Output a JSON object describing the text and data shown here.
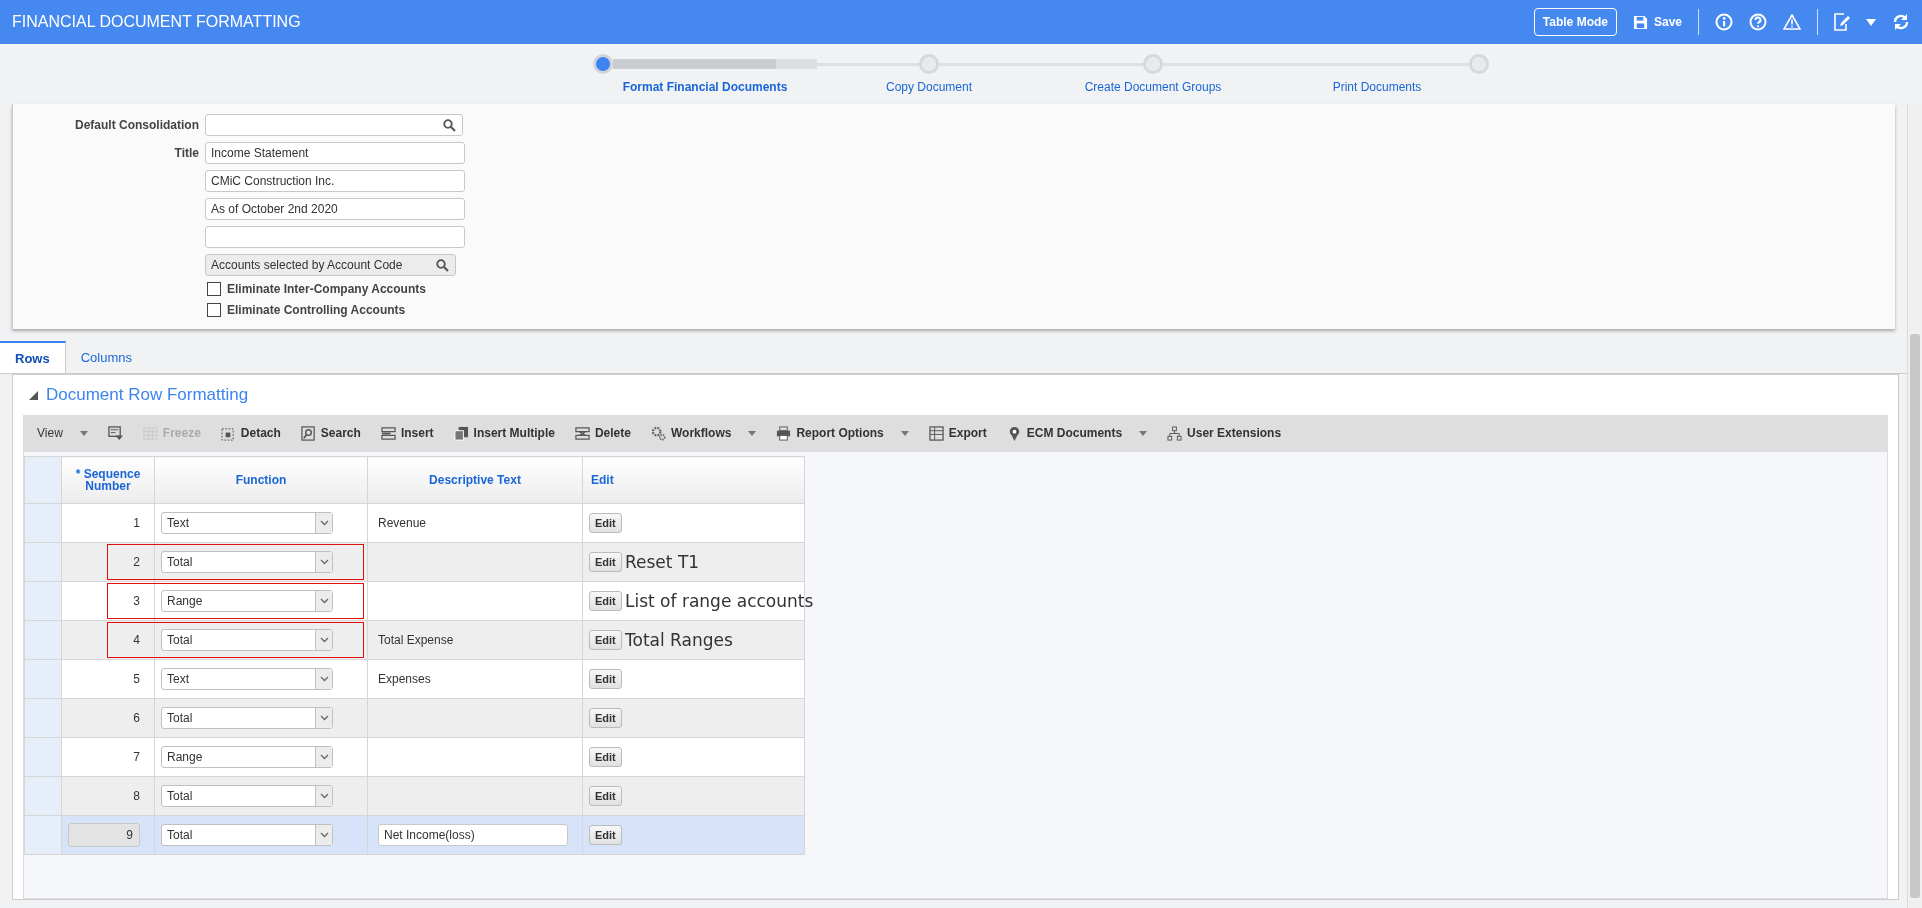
{
  "header": {
    "title": "FINANCIAL DOCUMENT FORMATTING",
    "table_mode": "Table Mode",
    "save": "Save"
  },
  "steps": [
    {
      "label": "Format Financial Documents",
      "selected": true
    },
    {
      "label": "Copy Document",
      "selected": false
    },
    {
      "label": "Create Document Groups",
      "selected": false
    },
    {
      "label": "Print Documents",
      "selected": false
    }
  ],
  "form": {
    "consolidation_label": "Default Consolidation",
    "title_label": "Title",
    "title_lines": [
      "Income Statement",
      "CMiC Construction Inc.",
      "As of October 2nd 2020"
    ],
    "blank_title_line": true,
    "account_selection": "Accounts selected by Account Code",
    "checkboxes": [
      {
        "label": "Eliminate Inter-Company Accounts",
        "checked": false
      },
      {
        "label": "Eliminate Controlling Accounts",
        "checked": false
      }
    ]
  },
  "tabs": [
    {
      "label": "Rows",
      "selected": true
    },
    {
      "label": "Columns",
      "selected": false
    }
  ],
  "section_title": "Document Row Formatting",
  "toolbar": [
    {
      "label": "View",
      "disabled": false,
      "dropdown": true
    },
    {
      "disabled": false,
      "dropdown": false
    },
    {
      "label": "Freeze",
      "disabled": true,
      "dropdown": false
    },
    {
      "label": "Detach",
      "disabled": false,
      "dropdown": false
    },
    {
      "label": "Search",
      "disabled": false,
      "dropdown": false
    },
    {
      "label": "Insert",
      "disabled": false,
      "dropdown": false
    },
    {
      "label": "Insert Multiple",
      "disabled": false,
      "dropdown": false
    },
    {
      "label": "Delete",
      "disabled": false,
      "dropdown": false
    },
    {
      "label": "Workflows",
      "disabled": false,
      "dropdown": true
    },
    {
      "label": "Report Options",
      "disabled": false,
      "dropdown": true
    },
    {
      "label": "Export",
      "disabled": false,
      "dropdown": false
    },
    {
      "label": "ECM Documents",
      "disabled": false,
      "dropdown": true
    },
    {
      "label": "User Extensions",
      "disabled": false,
      "dropdown": false
    }
  ],
  "table": {
    "columns": [
      "* Sequence Number",
      "Function",
      "Descriptive Text",
      "Edit"
    ],
    "rows": [
      {
        "sequence": "1",
        "function": "Text",
        "text": "Revenue",
        "edit": "Edit",
        "boxed": false,
        "selected": false
      },
      {
        "sequence": "2",
        "function": "Total",
        "edit": "Edit",
        "note": "Reset T1",
        "boxed": true,
        "selected": false
      },
      {
        "sequence": "3",
        "function": "Range",
        "edit": "Edit",
        "note": "List of range accounts",
        "boxed": true,
        "selected": false
      },
      {
        "sequence": "4",
        "function": "Total",
        "text": "Total Expense",
        "edit": "Edit",
        "note": "Total Ranges",
        "boxed": true,
        "selected": false
      },
      {
        "sequence": "5",
        "function": "Text",
        "text": "Expenses",
        "edit": "Edit",
        "boxed": false,
        "selected": false
      },
      {
        "sequence": "6",
        "function": "Total",
        "edit": "Edit",
        "boxed": false,
        "selected": false
      },
      {
        "sequence": "7",
        "function": "Range",
        "edit": "Edit",
        "boxed": false,
        "selected": false
      },
      {
        "sequence": "8",
        "function": "Total",
        "edit": "Edit",
        "boxed": false,
        "selected": false
      },
      {
        "sequence": "9",
        "function": "Total",
        "text": "Net Income(loss)",
        "edit": "Edit",
        "boxed": false,
        "selected": true
      }
    ]
  }
}
